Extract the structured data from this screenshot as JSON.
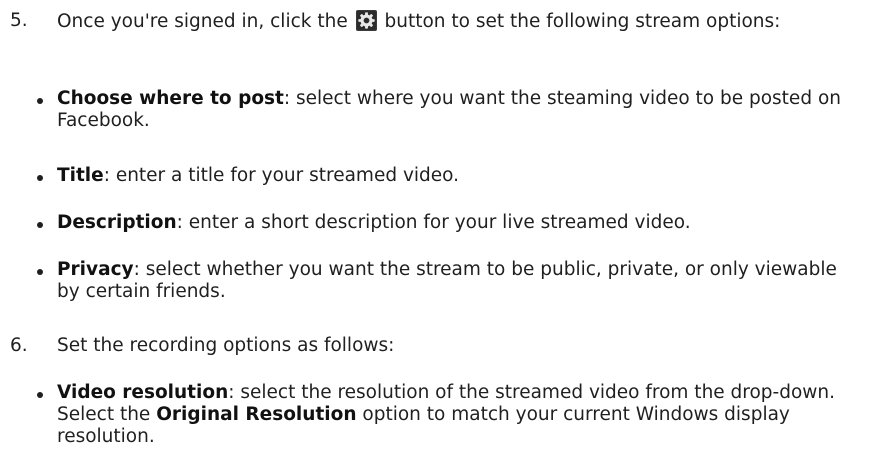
{
  "step5": {
    "number": "5.",
    "before_icon": "Once you're signed in, click the",
    "icon": "gear-icon",
    "after_icon": "button to set the following stream options:"
  },
  "stream_options": [
    {
      "label": "Choose where to post",
      "text": ": select where you want the steaming video to be posted on Facebook."
    },
    {
      "label": "Title",
      "text": ": enter a title for your streamed video."
    },
    {
      "label": "Description",
      "text": ": enter a short description for your live streamed video."
    },
    {
      "label": "Privacy",
      "text": ": select whether you want the stream to be public, private, or only viewable by certain friends."
    }
  ],
  "step6": {
    "number": "6.",
    "text": "Set the recording options as follows:"
  },
  "recording_options": [
    {
      "label": "Video resolution",
      "text_before": ": select the resolution of the streamed video from the drop-down. Select the ",
      "emphasis": "Original Resolution",
      "text_after": " option to match your current Windows display resolution."
    }
  ]
}
